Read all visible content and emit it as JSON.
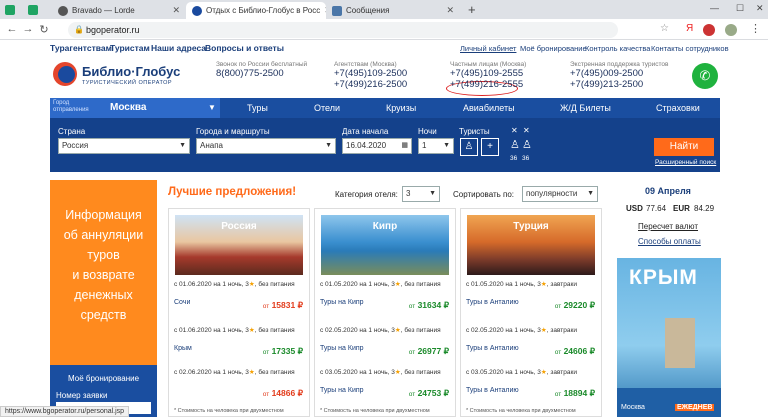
{
  "browser": {
    "tabs": [
      {
        "label": "Bravado — Lorde"
      },
      {
        "label": "Отдых с Библио-Глобус в Росс"
      },
      {
        "label": "Сообщения"
      }
    ],
    "url": "bgoperator.ru",
    "status_url": "https://www.bgoperator.ru/personal.jsp"
  },
  "topnav": {
    "left": [
      "Турагентствам",
      "Туристам",
      "Наши адреса",
      "Вопросы и ответы"
    ],
    "right": [
      "Личный кабинет",
      "Моё бронирование",
      "Контроль качества",
      "Контакты сотрудников"
    ]
  },
  "header": {
    "logo_name": "Библио·Глобус",
    "logo_sub": "туристический оператор",
    "contacts": [
      {
        "label": "Звонок по России бесплатный",
        "phones": [
          "8(800)775-2500"
        ]
      },
      {
        "label": "Агентствам (Москва)",
        "phones": [
          "+7(495)109-2500",
          "+7(499)216-2500"
        ]
      },
      {
        "label": "Частным лицам (Москва)",
        "phones": [
          "+7(495)109-2555",
          "+7(499)216-2555"
        ]
      },
      {
        "label": "Экстренная поддержка туристов",
        "phones": [
          "+7(495)009-2500",
          "+7(499)213-2500"
        ]
      }
    ]
  },
  "menu": {
    "city_label": "Город отправления",
    "city": "Москва",
    "items": [
      "Туры",
      "Отели",
      "Круизы",
      "Авиабилеты",
      "Ж/Д Билеты",
      "Страховки"
    ]
  },
  "search": {
    "country_label": "Страна",
    "country": "Россия",
    "city_label": "Города и маршруты",
    "city": "Анапа",
    "date_label": "Дата начала",
    "date": "16.04.2020",
    "nights_label": "Ночи",
    "nights": "1",
    "tourists_label": "Туристы",
    "child_ages": [
      "36",
      "36"
    ],
    "find": "Найти",
    "advanced": "Расширенный поиск"
  },
  "banner": {
    "lines": [
      "Информация",
      "об аннуляции",
      "туров",
      "и возврате",
      "денежных",
      "средств"
    ]
  },
  "booking": {
    "title": "Моё бронирование",
    "field": "Номер заявки"
  },
  "offers": {
    "heading": "Лучшие предложения!",
    "category_label": "Категория отеля:",
    "category": "3",
    "sort_label": "Сортировать по:",
    "sort": "популярности",
    "cards": [
      {
        "title": "Россия",
        "rows": [
          {
            "text": "c 01.06.2020 на 1 ночь,",
            "stars": "3",
            "extra": "без питания",
            "dest": "Сочи",
            "price": "15831",
            "red": true
          },
          {
            "text": "c 01.06.2020 на 1 ночь,",
            "stars": "3",
            "extra": "без питания",
            "dest": "Крым",
            "price": "17335",
            "red": false
          },
          {
            "text": "c 02.06.2020 на 1 ночь,",
            "stars": "3",
            "extra": "без питания",
            "dest": "",
            "price": "14866",
            "red": true
          }
        ]
      },
      {
        "title": "Кипр",
        "rows": [
          {
            "text": "c 01.05.2020 на 1 ночь,",
            "stars": "3",
            "extra": "без питания",
            "dest": "Туры на Кипр",
            "price": "31634",
            "red": false
          },
          {
            "text": "c 02.05.2020 на 1 ночь,",
            "stars": "3",
            "extra": "без питания",
            "dest": "Туры на Кипр",
            "price": "26977",
            "red": false
          },
          {
            "text": "c 03.05.2020 на 1 ночь,",
            "stars": "3",
            "extra": "без питания",
            "dest": "Туры на Кипр",
            "price": "24753",
            "red": false
          }
        ]
      },
      {
        "title": "Турция",
        "rows": [
          {
            "text": "c 01.05.2020 на 1 ночь,",
            "stars": "3",
            "extra": "завтраки",
            "dest": "Туры в Анталию",
            "price": "29220",
            "red": false
          },
          {
            "text": "c 02.05.2020 на 1 ночь,",
            "stars": "3",
            "extra": "завтраки",
            "dest": "Туры в Анталию",
            "price": "24606",
            "red": false
          },
          {
            "text": "c 03.05.2020 на 1 ночь,",
            "stars": "3",
            "extra": "завтраки",
            "dest": "Туры в Анталию",
            "price": "18894",
            "red": false
          }
        ]
      }
    ],
    "price_prefix": "от",
    "footnote": "* Стоимость на человека при двухместном"
  },
  "rates": {
    "date": "09 Апреля",
    "usd_label": "USD",
    "usd": "77.64",
    "eur_label": "EUR",
    "eur": "84.29",
    "recalc": "Пересчет валют",
    "payment": "Способы оплаты"
  },
  "crimea": {
    "title": "КРЫМ",
    "city": "Москва",
    "tag": "ЕЖЕДНЕВ"
  }
}
